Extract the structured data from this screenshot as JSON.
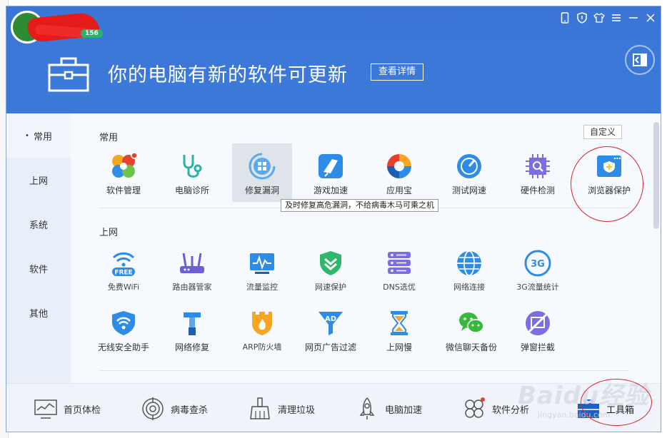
{
  "window": {
    "user_level": "156"
  },
  "banner": {
    "title": "你的电脑有新的软件可更新",
    "detail_button": "查看详情"
  },
  "nav": [
    {
      "label": "常用",
      "icon": "dot"
    },
    {
      "label": "上网"
    },
    {
      "label": "系统"
    },
    {
      "label": "软件"
    },
    {
      "label": "其他"
    }
  ],
  "sections": {
    "common": {
      "title": "常用",
      "custom_button": "自定义",
      "tiles": [
        {
          "label": "软件管理",
          "icon": "software-manager-icon"
        },
        {
          "label": "电脑诊所",
          "icon": "stethoscope-icon"
        },
        {
          "label": "修复漏洞",
          "icon": "repair-vulnerability-icon"
        },
        {
          "label": "游戏加速",
          "icon": "game-boost-icon"
        },
        {
          "label": "应用宝",
          "icon": "app-store-icon"
        },
        {
          "label": "测试网速",
          "icon": "speedometer-icon"
        },
        {
          "label": "硬件检测",
          "icon": "hardware-check-icon"
        },
        {
          "label": "浏览器保护",
          "icon": "browser-protection-icon"
        }
      ],
      "tooltip": "及时修复高危漏洞，不给病毒木马可乘之机"
    },
    "internet": {
      "title": "上网",
      "row1": [
        {
          "label": "免费WiFi",
          "icon": "wifi-free-icon",
          "badge": "FREE"
        },
        {
          "label": "路由器管家",
          "icon": "router-icon"
        },
        {
          "label": "流量监控",
          "icon": "traffic-monitor-icon"
        },
        {
          "label": "网速保护",
          "icon": "speed-shield-icon"
        },
        {
          "label": "DNS选优",
          "icon": "dns-server-icon"
        },
        {
          "label": "网络连接",
          "icon": "globe-icon"
        },
        {
          "label": "3G流量统计",
          "icon": "3g-icon",
          "badge": "3G"
        }
      ],
      "row2": [
        {
          "label": "无线安全助手",
          "icon": "wifi-shield-icon"
        },
        {
          "label": "网络修复",
          "icon": "hammer-icon"
        },
        {
          "label": "ARP防火墙",
          "icon": "firewall-icon"
        },
        {
          "label": "网页广告过滤",
          "icon": "ad-filter-icon",
          "badge": "AD"
        },
        {
          "label": "上网慢",
          "icon": "hourglass-icon"
        },
        {
          "label": "微信聊天备份",
          "icon": "wechat-icon"
        },
        {
          "label": "弹窗拦截",
          "icon": "popup-block-icon"
        }
      ]
    }
  },
  "bottom_nav": [
    {
      "label": "首页体检",
      "icon": "monitor-chart-icon"
    },
    {
      "label": "病毒查杀",
      "icon": "target-icon"
    },
    {
      "label": "清理垃圾",
      "icon": "broom-icon"
    },
    {
      "label": "电脑加速",
      "icon": "rocket-icon"
    },
    {
      "label": "软件分析",
      "icon": "puzzle-icon"
    },
    {
      "label": "工具箱",
      "icon": "toolbox-icon"
    }
  ],
  "watermark": {
    "brand": "Baidu经验",
    "url": "jingyan.baidu.com"
  },
  "colors": {
    "header_blue": "#3b76d6",
    "highlight_red": "#d9242b"
  }
}
